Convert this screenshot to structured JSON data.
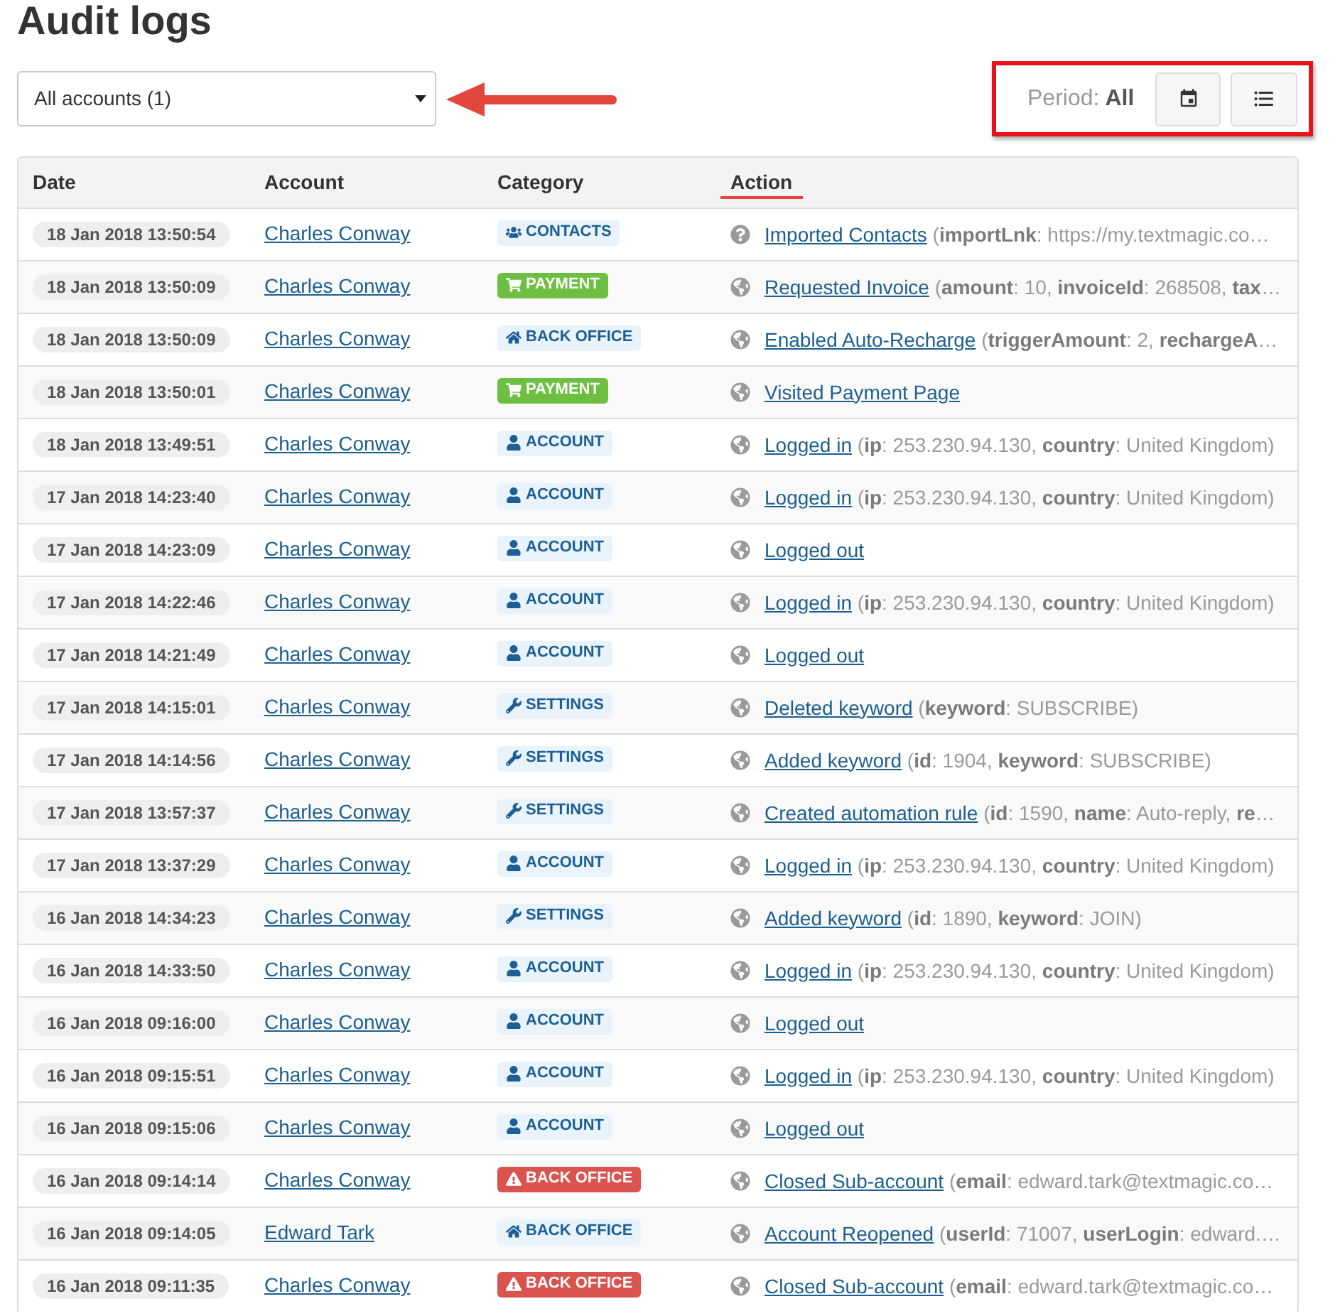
{
  "page": {
    "title": "Audit logs"
  },
  "account_select": {
    "value": "All accounts (1)"
  },
  "period": {
    "label": "Period:",
    "value": "All"
  },
  "table": {
    "columns": [
      {
        "label": "Date",
        "highlighted": false
      },
      {
        "label": "Account",
        "highlighted": false
      },
      {
        "label": "Category",
        "highlighted": false
      },
      {
        "label": "Action",
        "highlighted": true
      }
    ],
    "rows": [
      {
        "date": "18 Jan 2018 13:50:54",
        "account": "Charles Conway",
        "category": {
          "label": "CONTACTS",
          "kind": "contacts",
          "color": "#e8f3fc"
        },
        "action": {
          "kind": "question",
          "link": "Imported Contacts",
          "details": "(**importLnk**: https://my.textmagic.co…"
        }
      },
      {
        "date": "18 Jan 2018 13:50:09",
        "account": "Charles Conway",
        "category": {
          "label": "PAYMENT",
          "kind": "payment",
          "color": "#6cbf40"
        },
        "action": {
          "kind": "globe",
          "link": "Requested Invoice",
          "details": "(**amount**: 10, **invoiceId**: 268508, **tax**…"
        }
      },
      {
        "date": "18 Jan 2018 13:50:09",
        "account": "Charles Conway",
        "category": {
          "label": "BACK OFFICE",
          "kind": "office",
          "color": "#e8f3fc"
        },
        "action": {
          "kind": "globe",
          "link": "Enabled Auto-Recharge",
          "details": "(**triggerAmount**: 2, **rechargeA**…"
        }
      },
      {
        "date": "18 Jan 2018 13:50:01",
        "account": "Charles Conway",
        "category": {
          "label": "PAYMENT",
          "kind": "payment",
          "color": "#6cbf40"
        },
        "action": {
          "kind": "globe",
          "link": "Visited Payment Page"
        }
      },
      {
        "date": "18 Jan 2018 13:49:51",
        "account": "Charles Conway",
        "category": {
          "label": "ACCOUNT",
          "kind": "account",
          "color": "#e8f3fc"
        },
        "action": {
          "kind": "globe",
          "link": "Logged in",
          "details": "(**ip**: 253.230.94.130, **country**: United Kingdom)"
        }
      },
      {
        "date": "17 Jan 2018 14:23:40",
        "account": "Charles Conway",
        "category": {
          "label": "ACCOUNT",
          "kind": "account",
          "color": "#e8f3fc"
        },
        "action": {
          "kind": "globe",
          "link": "Logged in",
          "details": "(**ip**: 253.230.94.130, **country**: United Kingdom)"
        }
      },
      {
        "date": "17 Jan 2018 14:23:09",
        "account": "Charles Conway",
        "category": {
          "label": "ACCOUNT",
          "kind": "account",
          "color": "#e8f3fc"
        },
        "action": {
          "kind": "globe",
          "link": "Logged out"
        }
      },
      {
        "date": "17 Jan 2018 14:22:46",
        "account": "Charles Conway",
        "category": {
          "label": "ACCOUNT",
          "kind": "account",
          "color": "#e8f3fc"
        },
        "action": {
          "kind": "globe",
          "link": "Logged in",
          "details": "(**ip**: 253.230.94.130, **country**: United Kingdom)"
        }
      },
      {
        "date": "17 Jan 2018 14:21:49",
        "account": "Charles Conway",
        "category": {
          "label": "ACCOUNT",
          "kind": "account",
          "color": "#e8f3fc"
        },
        "action": {
          "kind": "globe",
          "link": "Logged out"
        }
      },
      {
        "date": "17 Jan 2018 14:15:01",
        "account": "Charles Conway",
        "category": {
          "label": "SETTINGS",
          "kind": "settings",
          "color": "#e8f3fc"
        },
        "action": {
          "kind": "globe",
          "link": "Deleted keyword",
          "details": "(**keyword**: SUBSCRIBE)"
        }
      },
      {
        "date": "17 Jan 2018 14:14:56",
        "account": "Charles Conway",
        "category": {
          "label": "SETTINGS",
          "kind": "settings",
          "color": "#e8f3fc"
        },
        "action": {
          "kind": "globe",
          "link": "Added keyword",
          "details": "(**id**: 1904, **keyword**: SUBSCRIBE)"
        }
      },
      {
        "date": "17 Jan 2018 13:57:37",
        "account": "Charles Conway",
        "category": {
          "label": "SETTINGS",
          "kind": "settings",
          "color": "#e8f3fc"
        },
        "action": {
          "kind": "globe",
          "link": "Created automation rule",
          "details": "(**id**: 1590, **name**: Auto-reply, **re**…"
        }
      },
      {
        "date": "17 Jan 2018 13:37:29",
        "account": "Charles Conway",
        "category": {
          "label": "ACCOUNT",
          "kind": "account",
          "color": "#e8f3fc"
        },
        "action": {
          "kind": "globe",
          "link": "Logged in",
          "details": "(**ip**: 253.230.94.130, **country**: United Kingdom)"
        }
      },
      {
        "date": "16 Jan 2018 14:34:23",
        "account": "Charles Conway",
        "category": {
          "label": "SETTINGS",
          "kind": "settings",
          "color": "#e8f3fc"
        },
        "action": {
          "kind": "globe",
          "link": "Added keyword",
          "details": "(**id**: 1890, **keyword**: JOIN)"
        }
      },
      {
        "date": "16 Jan 2018 14:33:50",
        "account": "Charles Conway",
        "category": {
          "label": "ACCOUNT",
          "kind": "account",
          "color": "#e8f3fc"
        },
        "action": {
          "kind": "globe",
          "link": "Logged in",
          "details": "(**ip**: 253.230.94.130, **country**: United Kingdom)"
        }
      },
      {
        "date": "16 Jan 2018 09:16:00",
        "account": "Charles Conway",
        "category": {
          "label": "ACCOUNT",
          "kind": "account",
          "color": "#e8f3fc"
        },
        "action": {
          "kind": "globe",
          "link": "Logged out"
        }
      },
      {
        "date": "16 Jan 2018 09:15:51",
        "account": "Charles Conway",
        "category": {
          "label": "ACCOUNT",
          "kind": "account",
          "color": "#e8f3fc"
        },
        "action": {
          "kind": "globe",
          "link": "Logged in",
          "details": "(**ip**: 253.230.94.130, **country**: United Kingdom)"
        }
      },
      {
        "date": "16 Jan 2018 09:15:06",
        "account": "Charles Conway",
        "category": {
          "label": "ACCOUNT",
          "kind": "account",
          "color": "#e8f3fc"
        },
        "action": {
          "kind": "globe",
          "link": "Logged out"
        }
      },
      {
        "date": "16 Jan 2018 09:14:14",
        "account": "Charles Conway",
        "category": {
          "label": "BACK OFFICE",
          "kind": "warning",
          "color": "#d9534f"
        },
        "action": {
          "kind": "globe",
          "link": "Closed Sub-account",
          "details": "(**email**: edward.tark@textmagic.co…"
        }
      },
      {
        "date": "16 Jan 2018 09:14:05",
        "account": "Edward Tark",
        "category": {
          "label": "BACK OFFICE",
          "kind": "office",
          "color": "#e8f3fc"
        },
        "action": {
          "kind": "globe",
          "link": "Account Reopened",
          "details": "(**userId**: 71007, **userLogin**: edward.…"
        }
      },
      {
        "date": "16 Jan 2018 09:11:35",
        "account": "Charles Conway",
        "category": {
          "label": "BACK OFFICE",
          "kind": "warning",
          "color": "#d9534f"
        },
        "action": {
          "kind": "globe",
          "link": "Closed Sub-account",
          "details": "(**email**: edward.tark@textmagic.co…"
        }
      }
    ]
  }
}
